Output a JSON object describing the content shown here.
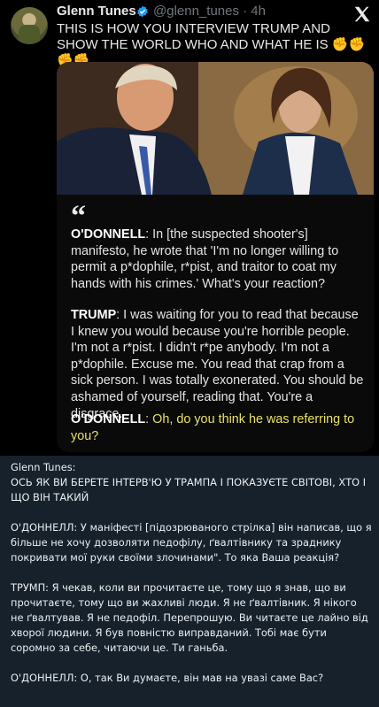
{
  "tweet": {
    "author_name": "Glenn Tunes",
    "handle_time": "@glenn_tunes · 4h",
    "text": "THIS IS HOW YOU INTERVIEW TRUMP AND SHOW THE WORLD WHO AND WHAT HE IS ✊✊✊✊",
    "quote_mark": "“",
    "quotes": [
      {
        "speaker": "O'DONNELL",
        "text": ": In [the suspected shooter's] manifesto, he wrote that 'I'm no longer willing to permit a p*dophile, r*pist, and traitor to coat my hands with his crimes.' What's your reaction?"
      },
      {
        "speaker": "TRUMP",
        "text": ": I was waiting for you to read that because I knew you would because you're horrible people. I'm not a r*pist. I didn't r*pe anybody. I'm not a p*dophile. Excuse me. You read that crap from a sick person. I was totally exonerated. You should be ashamed of yourself, reading that. You're a disgrace."
      },
      {
        "speaker": "O'DONNELL",
        "text": ": Oh, do you think he was referring to you?"
      }
    ]
  },
  "message": {
    "sender_line": "Glenn Tunes:",
    "headline": "ОСЬ ЯК ВИ БЕРЕТЕ ІНТЕРВ'Ю У ТРАМПА І ПОКАЗУЄТЕ СВІТОВІ, ХТО І ЩО ВІН ТАКИЙ",
    "p1": "О'ДОННЕЛЛ: У маніфесті [підозрюваного стрілка] він написав, що я більше не хочу дозволяти педофілу, ґвалтівнику та зраднику покривати мої руки своїми злочинами\". То яка Ваша реакція?",
    "p2": "ТРУМП: Я чекав, коли ви прочитаєте це, тому що я знав, що ви прочитаєте, тому що ви жахливі люди. Я не ґвалтівник. Я нікого не ґвалтував. Я не педофіл. Перепрошую. Ви читаєте це лайно від хворої людини. Я був повністю виправданий. Тобі має бути соромно за себе, читаючи це. Ти ганьба.",
    "p3": "О'ДОННЕЛЛ: О, так Ви думаєте, він мав на увазі саме Вас?"
  },
  "colors": {
    "verified": "#1d9bf0",
    "highlight": "#e8e06a",
    "chat_bg": "#17212b"
  }
}
